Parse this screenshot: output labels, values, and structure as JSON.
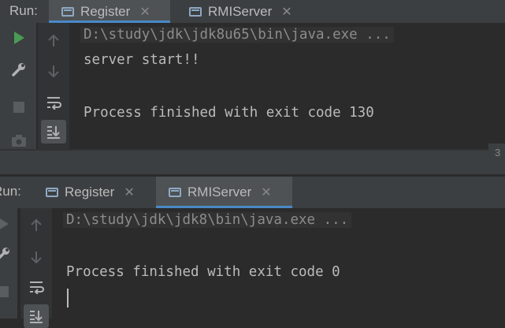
{
  "top_panel": {
    "run_label": "Run:",
    "tabs": [
      {
        "label": "Register",
        "active": true
      },
      {
        "label": "RMIServer",
        "active": false
      }
    ],
    "command": "D:\\study\\jdk\\jdk8u65\\bin\\java.exe ...",
    "lines": [
      "server start!!",
      "",
      "Process finished with exit code 130"
    ]
  },
  "divider_number": "3",
  "bottom_panel": {
    "run_label": "Run:",
    "tabs": [
      {
        "label": "Register",
        "active": false
      },
      {
        "label": "RMIServer",
        "active": true
      }
    ],
    "command": "D:\\study\\jdk\\jdk8\\bin\\java.exe ...",
    "lines": [
      "",
      "Process finished with exit code 0"
    ]
  },
  "colors": {
    "accent": "#4a88c7",
    "run_green": "#499c54",
    "bg": "#2b2b2b",
    "toolbar": "#3c3f41"
  }
}
